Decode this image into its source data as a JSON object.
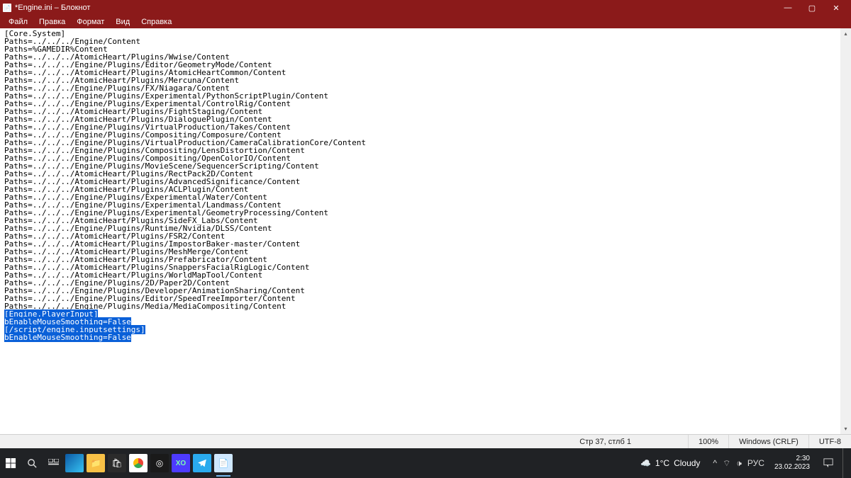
{
  "titlebar": {
    "title": "*Engine.ini – Блокнот"
  },
  "window_controls": {
    "min": "—",
    "max": "▢",
    "close": "✕"
  },
  "menu": {
    "file": "Файл",
    "edit": "Правка",
    "format": "Формат",
    "view": "Вид",
    "help": "Справка"
  },
  "content": {
    "plain": "[Core.System]\nPaths=../../../Engine/Content\nPaths=%GAMEDIR%Content\nPaths=../../../AtomicHeart/Plugins/Wwise/Content\nPaths=../../../Engine/Plugins/Editor/GeometryMode/Content\nPaths=../../../AtomicHeart/Plugins/AtomicHeartCommon/Content\nPaths=../../../AtomicHeart/Plugins/Mercuna/Content\nPaths=../../../Engine/Plugins/FX/Niagara/Content\nPaths=../../../Engine/Plugins/Experimental/PythonScriptPlugin/Content\nPaths=../../../Engine/Plugins/Experimental/ControlRig/Content\nPaths=../../../AtomicHeart/Plugins/FightStaging/Content\nPaths=../../../AtomicHeart/Plugins/DialoguePlugin/Content\nPaths=../../../Engine/Plugins/VirtualProduction/Takes/Content\nPaths=../../../Engine/Plugins/Compositing/Composure/Content\nPaths=../../../Engine/Plugins/VirtualProduction/CameraCalibrationCore/Content\nPaths=../../../Engine/Plugins/Compositing/LensDistortion/Content\nPaths=../../../Engine/Plugins/Compositing/OpenColorIO/Content\nPaths=../../../Engine/Plugins/MovieScene/SequencerScripting/Content\nPaths=../../../AtomicHeart/Plugins/RectPack2D/Content\nPaths=../../../AtomicHeart/Plugins/AdvancedSignificance/Content\nPaths=../../../AtomicHeart/Plugins/ACLPlugin/Content\nPaths=../../../Engine/Plugins/Experimental/Water/Content\nPaths=../../../Engine/Plugins/Experimental/Landmass/Content\nPaths=../../../Engine/Plugins/Experimental/GeometryProcessing/Content\nPaths=../../../AtomicHeart/Plugins/SideFX_Labs/Content\nPaths=../../../Engine/Plugins/Runtime/Nvidia/DLSS/Content\nPaths=../../../AtomicHeart/Plugins/FSR2/Content\nPaths=../../../AtomicHeart/Plugins/ImpostorBaker-master/Content\nPaths=../../../AtomicHeart/Plugins/MeshMerge/Content\nPaths=../../../AtomicHeart/Plugins/Prefabricator/Content\nPaths=../../../AtomicHeart/Plugins/SnappersFacialRigLogic/Content\nPaths=../../../AtomicHeart/Plugins/WorldMapTool/Content\nPaths=../../../Engine/Plugins/2D/Paper2D/Content\nPaths=../../../Engine/Plugins/Developer/AnimationSharing/Content\nPaths=../../../Engine/Plugins/Editor/SpeedTreeImporter/Content\nPaths=../../../Engine/Plugins/Media/MediaCompositing/Content",
    "selected": "[Engine.PlayerInput]\nbEnableMouseSmoothing=False\n[/script/engine.inputsettings]\nbEnableMouseSmoothing=False"
  },
  "status": {
    "pos": "Стр 37, стлб 1",
    "zoom": "100%",
    "eol": "Windows (CRLF)",
    "enc": "UTF-8"
  },
  "taskbar": {
    "weather_temp": "1°C",
    "weather_text": "Cloudy",
    "lang": "РУС",
    "time": "2:30",
    "date": "23.02.2023",
    "tray_up": "^",
    "tray_net": "⌔",
    "tray_vol": "🕩"
  }
}
